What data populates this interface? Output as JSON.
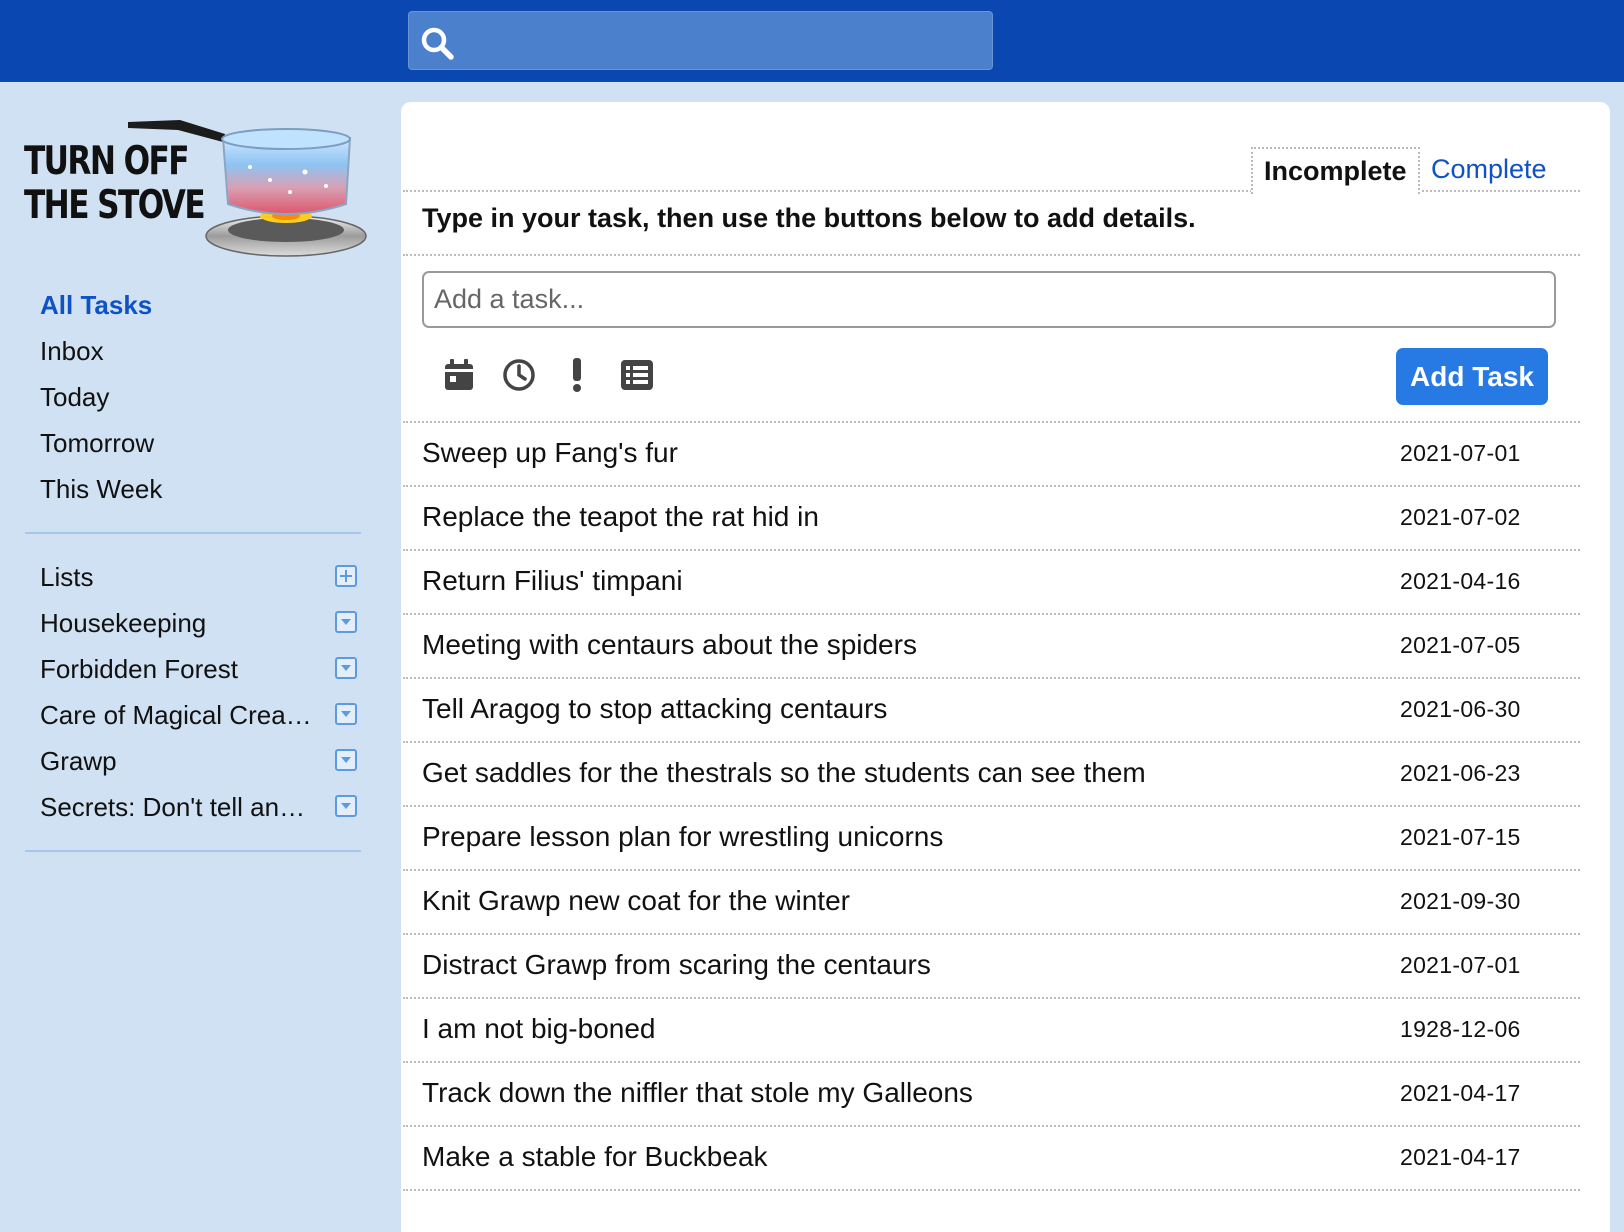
{
  "search": {
    "placeholder": "",
    "value": ""
  },
  "brand": {
    "logo_text": "TURN OFF\nTHE STOVE",
    "colors": {
      "topbar": "#0a47b0",
      "accent": "#0f52c4",
      "button": "#2779e3",
      "sidebar": "#d0e1f3"
    }
  },
  "nav": {
    "items": [
      {
        "label": "All Tasks",
        "active": true
      },
      {
        "label": "Inbox"
      },
      {
        "label": "Today"
      },
      {
        "label": "Tomorrow"
      },
      {
        "label": "This Week"
      }
    ]
  },
  "lists": {
    "header": "Lists",
    "header_icon": "plus-square-icon",
    "items": [
      {
        "label": "Housekeeping",
        "icon": "dropdown-square-icon"
      },
      {
        "label": "Forbidden Forest",
        "icon": "dropdown-square-icon"
      },
      {
        "label": "Care of Magical Creatures",
        "icon": "dropdown-square-icon"
      },
      {
        "label": "Grawp",
        "icon": "dropdown-square-icon"
      },
      {
        "label": "Secrets: Don't tell anyone",
        "icon": "dropdown-square-icon"
      }
    ]
  },
  "tabs": {
    "incomplete": "Incomplete",
    "complete": "Complete",
    "selected": "Incomplete"
  },
  "composer": {
    "instructions": "Type in your task, then use the buttons below to add details.",
    "placeholder": "Add a task...",
    "tools": [
      "calendar-icon",
      "clock-icon",
      "exclamation-icon",
      "list-icon"
    ],
    "add_label": "Add Task"
  },
  "tasks": [
    {
      "title": "Sweep up Fang's fur",
      "date": "2021-07-01"
    },
    {
      "title": "Replace the teapot the rat hid in",
      "date": "2021-07-02"
    },
    {
      "title": "Return Filius' timpani",
      "date": "2021-04-16"
    },
    {
      "title": "Meeting with centaurs about the spiders",
      "date": "2021-07-05"
    },
    {
      "title": "Tell Aragog to stop attacking centaurs",
      "date": "2021-06-30"
    },
    {
      "title": "Get saddles for the thestrals so the students can see them",
      "date": "2021-06-23"
    },
    {
      "title": "Prepare lesson plan for wrestling unicorns",
      "date": "2021-07-15"
    },
    {
      "title": "Knit Grawp new coat for the winter",
      "date": "2021-09-30"
    },
    {
      "title": "Distract Grawp from scaring the centaurs",
      "date": "2021-07-01"
    },
    {
      "title": "I am not big-boned",
      "date": "1928-12-06"
    },
    {
      "title": "Track down the niffler that stole my Galleons",
      "date": "2021-04-17"
    },
    {
      "title": "Make a stable for Buckbeak",
      "date": "2021-04-17"
    }
  ]
}
